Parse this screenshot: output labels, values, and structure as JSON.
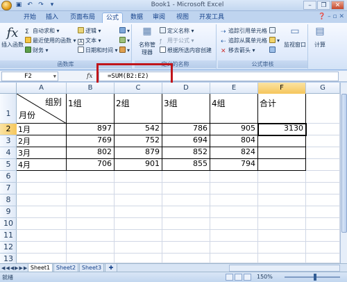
{
  "window": {
    "title": "Book1 - Microsoft Excel",
    "controls": [
      "–",
      "❐",
      "✕"
    ]
  },
  "ribbon_tabs": [
    "开始",
    "插入",
    "页面布局",
    "公式",
    "数据",
    "审阅",
    "视图",
    "开发工具"
  ],
  "active_tab": "公式",
  "ribbon": {
    "insert_function": "插入函数",
    "library": {
      "autosum": "自动求和",
      "recent": "最近使用的函数",
      "finance": "财务",
      "logical": "逻辑",
      "text": "文本",
      "datetime": "日期和时间",
      "label": "函数库"
    },
    "names": {
      "name_manager": "名称管理器",
      "define_name": "定义名称",
      "use_in_formula": "用于公式",
      "create_from_selection": "根据所选内容创建",
      "label": "定义的名称"
    },
    "audit": {
      "trace_precedents": "追踪引用单元格",
      "trace_dependents": "追踪从属单元格",
      "remove_arrows": "移去箭头",
      "watch_window": "监视窗口",
      "label": "公式审核"
    },
    "calc": {
      "calculation": "计算"
    }
  },
  "formula_bar": {
    "name_box": "F2",
    "fx": "fx",
    "formula": "=SUM(B2:E2)"
  },
  "columns": [
    "A",
    "B",
    "C",
    "D",
    "E",
    "F",
    "G"
  ],
  "selected_column": "F",
  "rows": [
    "1",
    "2",
    "3",
    "4",
    "5",
    "6",
    "7",
    "8",
    "9",
    "10",
    "11",
    "12",
    "13"
  ],
  "selected_row": "2",
  "table": {
    "corner_top": "组别",
    "corner_bottom": "月份",
    "headers": [
      "1组",
      "2组",
      "3组",
      "4组",
      "合计"
    ],
    "data": [
      {
        "month": "1月",
        "values": [
          "897",
          "542",
          "786",
          "905"
        ],
        "total": "3130"
      },
      {
        "month": "2月",
        "values": [
          "769",
          "752",
          "694",
          "804"
        ],
        "total": ""
      },
      {
        "month": "3月",
        "values": [
          "802",
          "879",
          "852",
          "824"
        ],
        "total": ""
      },
      {
        "month": "4月",
        "values": [
          "706",
          "901",
          "855",
          "794"
        ],
        "total": ""
      }
    ]
  },
  "sheets": [
    "Sheet1",
    "Sheet2",
    "Sheet3"
  ],
  "active_sheet": "Sheet1",
  "status": {
    "mode": "就绪",
    "zoom": "150%"
  }
}
